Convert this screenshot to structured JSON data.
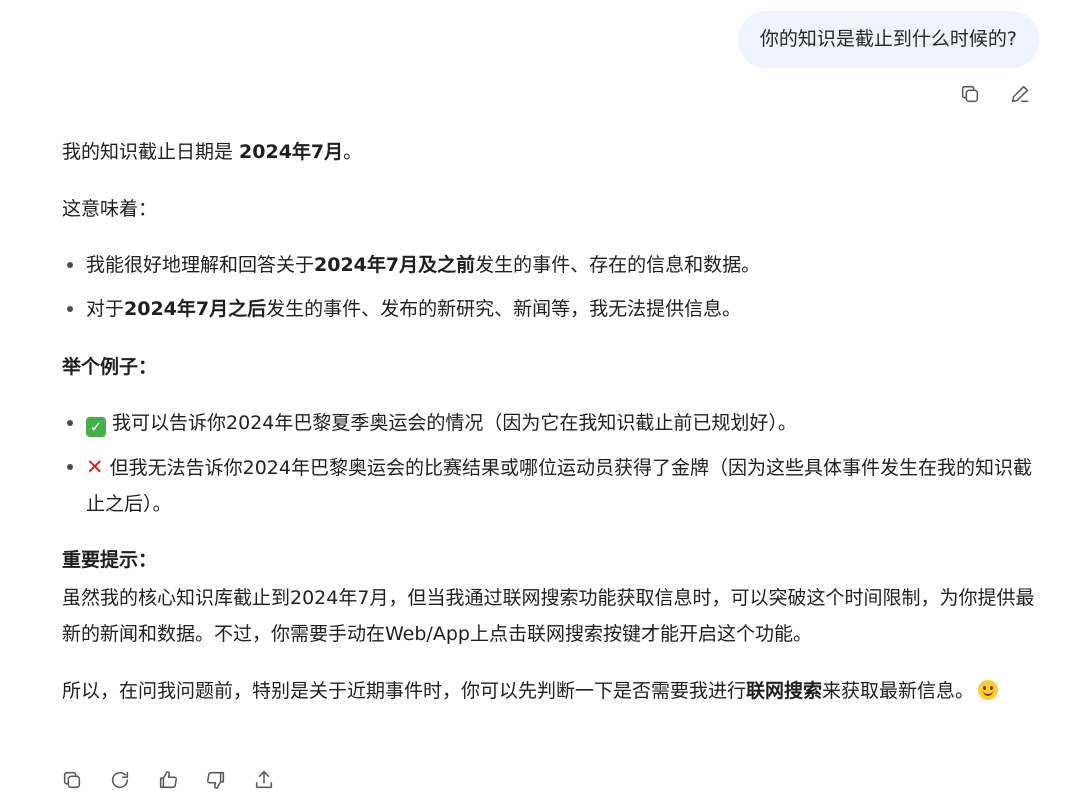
{
  "user_message": {
    "text": "你的知识是截止到什么时候的?"
  },
  "user_actions": {
    "copy_icon": "copy-icon",
    "edit_icon": "edit-icon"
  },
  "answer": {
    "p1_prefix": "我的知识截止日期是 ",
    "p1_bold": "2024年7月",
    "p1_suffix": "。",
    "p2": "这意味着：",
    "list1": [
      {
        "prefix": "我能很好地理解和回答关于",
        "bold": "2024年7月及之前",
        "suffix": "发生的事件、存在的信息和数据。"
      },
      {
        "prefix": "对于",
        "bold": "2024年7月之后",
        "suffix": "发生的事件、发布的新研究、新闻等，我无法提供信息。"
      }
    ],
    "heading1": "举个例子：",
    "list2": [
      {
        "emoji": "✓",
        "text": "我可以告诉你2024年巴黎夏季奥运会的情况（因为它在我知识截止前已规划好）。"
      },
      {
        "emoji": "✕",
        "text": "但我无法告诉你2024年巴黎奥运会的比赛结果或哪位运动员获得了金牌（因为这些具体事件发生在我的知识截止之后）。"
      }
    ],
    "heading2": "重要提示：",
    "p3": "虽然我的核心知识库截止到2024年7月，但当我通过联网搜索功能获取信息时，可以突破这个时间限制，为你提供最新的新闻和数据。不过，你需要手动在Web/App上点击联网搜索按键才能开启这个功能。",
    "p4_prefix": "所以，在问我问题前，特别是关于近期事件时，你可以先判断一下是否需要我进行",
    "p4_bold": "联网搜索",
    "p4_suffix": "来获取最新信息。"
  },
  "answer_actions": {
    "icons": [
      "copy-icon",
      "regenerate-icon",
      "thumbs-up-icon",
      "thumbs-down-icon",
      "share-icon"
    ]
  },
  "colors": {
    "user_bubble_bg": "#eff3fd",
    "text": "#1f1f1f",
    "icon": "#5a5a5a",
    "check_green": "#43b04a",
    "cross_red": "#e02020"
  }
}
